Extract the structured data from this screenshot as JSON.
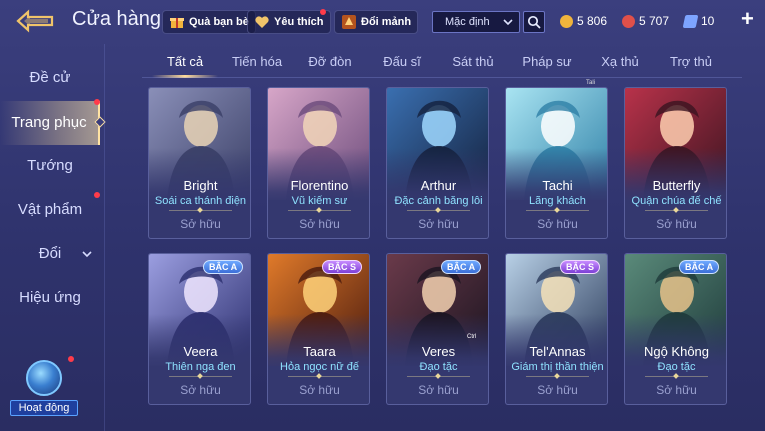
{
  "header": {
    "title": "Cửa hàng",
    "gift_label": "Quà bạn bè",
    "favorite_label": "Yêu thích",
    "exchange_label": "Đổi mảnh",
    "sort_value": "Mặc định",
    "currencies": [
      {
        "value": "5 806",
        "color": "#f0b43c"
      },
      {
        "value": "5 707",
        "color": "#e0504a"
      },
      {
        "value": "10",
        "color": "#7da4ff"
      }
    ]
  },
  "sidebar": {
    "items": [
      {
        "label": "Đề cử"
      },
      {
        "label": "Trang phục"
      },
      {
        "label": "Tướng"
      },
      {
        "label": "Vật phẩm"
      },
      {
        "label": "Đổi"
      },
      {
        "label": "Hiệu ứng"
      }
    ],
    "activity_label": "Hoạt động"
  },
  "tabs": [
    "Tất cả",
    "Tiến hóa",
    "Đỡ đòn",
    "Đấu sĩ",
    "Sát thủ",
    "Pháp sư",
    "Xạ thủ",
    "Trợ thủ"
  ],
  "tiny_tip": "Tali",
  "cards": [
    {
      "name": "Bright",
      "skin": "Soái ca thánh điện",
      "status": "Sở hữu",
      "badge": "",
      "c1": "#3a3f66",
      "c2": "#8a8fb8",
      "accent": "#e9d3b5"
    },
    {
      "name": "Florentino",
      "skin": "Vũ kiếm sư",
      "status": "Sở hữu",
      "badge": "",
      "c1": "#6a4a7a",
      "c2": "#d7a6c8",
      "accent": "#f2d6b8"
    },
    {
      "name": "Arthur",
      "skin": "Đặc cảnh băng lôi",
      "status": "Sở hữu",
      "badge": "",
      "c1": "#14213d",
      "c2": "#3a6fb0",
      "accent": "#9fd8ff"
    },
    {
      "name": "Tachi",
      "skin": "Lãng khách",
      "status": "Sở hữu",
      "badge": "",
      "c1": "#2e7fa6",
      "c2": "#a9e4f2",
      "accent": "#ffffff"
    },
    {
      "name": "Butterfly",
      "skin": "Quận chúa đế chế",
      "status": "Sở hữu",
      "badge": "",
      "c1": "#3a1420",
      "c2": "#b8324a",
      "accent": "#ffcfb0"
    },
    {
      "name": "Veera",
      "skin": "Thiên nga đen",
      "status": "Sở hữu",
      "badge": "BẬC A",
      "c1": "#2b2e6e",
      "c2": "#9b9ee0",
      "accent": "#f0e6ff"
    },
    {
      "name": "Taara",
      "skin": "Hỏa ngọc nữ đế",
      "status": "Sở hữu",
      "badge": "BẬC S",
      "c1": "#4a1a0e",
      "c2": "#e07a2a",
      "accent": "#ffd27a"
    },
    {
      "name": "Veres",
      "skin": "Đạo tặc",
      "status": "Sở hữu",
      "badge": "BẬC A",
      "c1": "#1a1420",
      "c2": "#6a3a4a",
      "accent": "#f3d1b0"
    },
    {
      "name": "Tel'Annas",
      "skin": "Giám thị thần thiện",
      "status": "Sở hữu",
      "badge": "BẬC S",
      "c1": "#2a3a5a",
      "c2": "#b8d0e6",
      "accent": "#f6e2b8"
    },
    {
      "name": "Ngộ Không",
      "skin": "Đạo tặc",
      "status": "Sở hữu",
      "badge": "BẬC A",
      "c1": "#1e3a3a",
      "c2": "#5a8a7a",
      "accent": "#e6c28a"
    }
  ],
  "ctrl_label": "Ctrl"
}
